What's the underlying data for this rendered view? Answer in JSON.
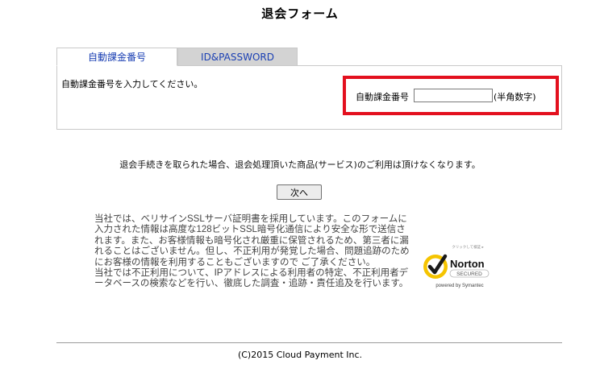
{
  "page": {
    "title": "退会フォーム"
  },
  "tabs": [
    {
      "label": "自動課金番号",
      "active": true
    },
    {
      "label": "ID&PASSWORD",
      "active": false
    }
  ],
  "form": {
    "instruction": "自動課金番号を入力してください。",
    "field_label": "自動課金番号",
    "field_value": "",
    "field_hint": "(半角数字)"
  },
  "notice": "退会手続きを取られた場合、退会処理頂いた商品(サービス)のご利用は頂けなくなります。",
  "next_button": "次へ",
  "security": {
    "paragraph1": "当社では、ベリサインSSLサーバ証明書を採用しています。このフォームに入力された情報は高度な128ビットSSL暗号化通信により安全な形で送信されます。また、お客様情報も暗号化され厳重に保管されるため、第三者に漏れることはございません。但し、不正利用が発覚した場合、問題追跡のためにお客様の情報を利用することもございますので ご了承ください。",
    "paragraph2": "当社では不正利用について、IPアドレスによる利用者の特定、不正利用者データベースの検索などを行い、徹底した調査・追跡・責任追及を行います。"
  },
  "seal": {
    "top_text": "クリックして検証 ▸",
    "brand": "Norton",
    "secured": "SECURED",
    "powered_by": "powered by Symantec",
    "check_color": "#f5c400"
  },
  "footer": {
    "copyright": "(C)2015 Cloud Payment Inc."
  },
  "colors": {
    "highlight": "#e3101e",
    "tab_text": "#1a3fb3",
    "inactive_tab_bg": "#d3d3d3"
  }
}
